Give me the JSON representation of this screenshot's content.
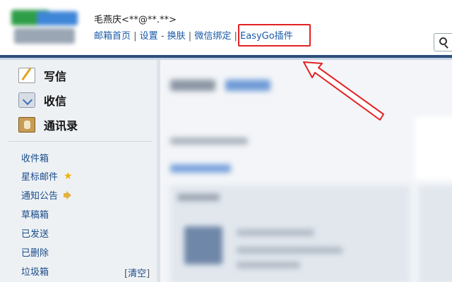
{
  "header": {
    "user_name": "毛燕庆",
    "user_email": "<**@**.**>",
    "links": {
      "home": "邮箱首页",
      "sep1": " | ",
      "settings": "设置",
      "dash": " - ",
      "skin": "换肤",
      "sep2": " | ",
      "wechat": "微信绑定",
      "sep3": " | ",
      "easygo": "EasyGo插件"
    }
  },
  "sidebar": {
    "actions": [
      {
        "label": "写信",
        "icon": "write-icon"
      },
      {
        "label": "收信",
        "icon": "inbox-icon"
      },
      {
        "label": "通讯录",
        "icon": "contacts-icon"
      }
    ],
    "folders": [
      {
        "label": "收件箱"
      },
      {
        "label": "星标邮件",
        "icon": "star-icon"
      },
      {
        "label": "通知公告",
        "icon": "speaker-icon"
      },
      {
        "label": "草稿箱"
      },
      {
        "label": "已发送"
      },
      {
        "label": "已删除"
      },
      {
        "label": "垃圾箱"
      }
    ],
    "clear": {
      "open": "[",
      "label": "清空",
      "close": "]"
    }
  },
  "colors": {
    "header_bar": "#2d4f7a",
    "link": "#1a5aa8",
    "highlight": "#e32222",
    "sidebar_bg": "#eef1f4",
    "star": "#f0b300"
  }
}
